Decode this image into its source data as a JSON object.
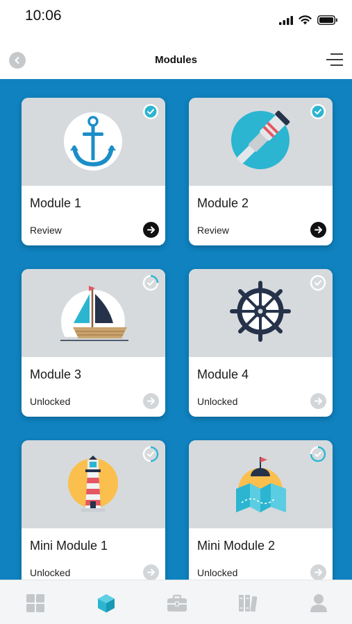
{
  "status_bar": {
    "time": "10:06"
  },
  "nav": {
    "title": "Modules",
    "back_icon": "chevron-left-icon",
    "menu_icon": "menu-icon"
  },
  "colors": {
    "background": "#0f82bf",
    "accent": "#2bb5d0",
    "card_image_bg": "#d6dadd"
  },
  "modules": [
    {
      "title": "Module 1",
      "status": "Review",
      "completed": true,
      "icon": "anchor-icon"
    },
    {
      "title": "Module 2",
      "status": "Review",
      "completed": true,
      "icon": "spyglass-icon"
    },
    {
      "title": "Module 3",
      "status": "Unlocked",
      "completed": false,
      "icon": "sailboat-icon"
    },
    {
      "title": "Module 4",
      "status": "Unlocked",
      "completed": false,
      "icon": "ship-wheel-icon"
    },
    {
      "title": "Mini Module 1",
      "status": "Unlocked",
      "completed": false,
      "icon": "lighthouse-icon"
    },
    {
      "title": "Mini Module 2",
      "status": "Unlocked",
      "completed": false,
      "icon": "treasure-map-icon"
    }
  ],
  "tab_bar": {
    "tabs": [
      {
        "icon": "dashboard-icon",
        "active": false
      },
      {
        "icon": "cube-icon",
        "active": true
      },
      {
        "icon": "briefcase-icon",
        "active": false
      },
      {
        "icon": "library-icon",
        "active": false
      },
      {
        "icon": "profile-icon",
        "active": false
      }
    ]
  }
}
